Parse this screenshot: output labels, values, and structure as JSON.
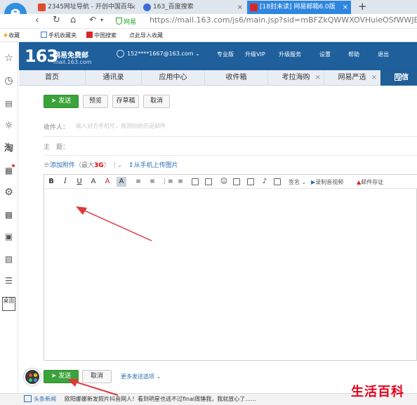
{
  "browser": {
    "logo_letter": "e",
    "tabs": [
      {
        "label": "2345网址导航 - 开创中国百年",
        "close": "×"
      },
      {
        "label": "163_百度搜索",
        "close": "×"
      },
      {
        "label": "[18封未读] 网易邮箱6.0版",
        "close": "×"
      }
    ],
    "new_tab": "+",
    "secure_label": "网易",
    "url": "https://mail.163.com/js6/main.jsp?sid=mBFZkQWWXOVHuieOSfWWJEycnwApM",
    "favorites": [
      {
        "label": "收藏"
      },
      {
        "label": "手机收藏夹"
      },
      {
        "label": "中国搜索"
      },
      {
        "label": "点此导入收藏"
      }
    ]
  },
  "sidebar": {
    "icons": [
      "star-icon",
      "history-icon",
      "news-icon",
      "chat-icon",
      "taobao-icon",
      "calendar-icon",
      "game-icon",
      "video-icon",
      "device-icon",
      "calculator-icon",
      "list-icon",
      "desktop-icon"
    ],
    "taobao_label": "淘",
    "desktop_label": "桌面"
  },
  "mail_header": {
    "logo_number": "163",
    "logo_title": "网易免费邮",
    "logo_domain": "mail.163.com",
    "user": "152****1667@163.com",
    "links": [
      "专业版",
      "升级VIP",
      "升级服务",
      "设置",
      "帮助",
      "退出"
    ]
  },
  "mail_tabs": [
    {
      "label": "首页"
    },
    {
      "label": "通讯录"
    },
    {
      "label": "应用中心"
    },
    {
      "label": "收件箱"
    },
    {
      "label": "考拉海购"
    },
    {
      "label": "网易严选"
    }
  ],
  "compose_tab": "写信",
  "compose": {
    "top_buttons": {
      "send": "发送",
      "preview": "预览",
      "draft": "存草稿",
      "cancel": "取消"
    },
    "to_label": "收件人：",
    "to_placeholder": "输入对方手机号，观测你给的是邮件",
    "subject_label": "主　题：",
    "attach_label": "添加附件",
    "attach_limit_prefix": "（最大",
    "attach_limit_value": "3G",
    "attach_limit_suffix": "）",
    "mobile_upload": "从手机上传图片",
    "editor_toolbar": {
      "bold": "B",
      "italic": "I",
      "underline": "U",
      "font_size": "A",
      "font_color": "A",
      "bg_color": "A",
      "signature": "签名",
      "record": "录制音视频",
      "postcard": "邮件存证"
    },
    "bottom_buttons": {
      "send": "发送",
      "cancel": "取消",
      "more": "更多发送选项"
    }
  },
  "news": {
    "label": "头条新闻",
    "text": "欧阳娜娜新发照片抖音网人！看到明星也逃不过final周锤我，我就放心了……"
  },
  "watermark": "生活百科",
  "colors": {
    "header": "#1e5f9c",
    "send_green": "#3aa33a",
    "arrow_red": "#e0383b",
    "link_blue": "#2b6cb3"
  }
}
